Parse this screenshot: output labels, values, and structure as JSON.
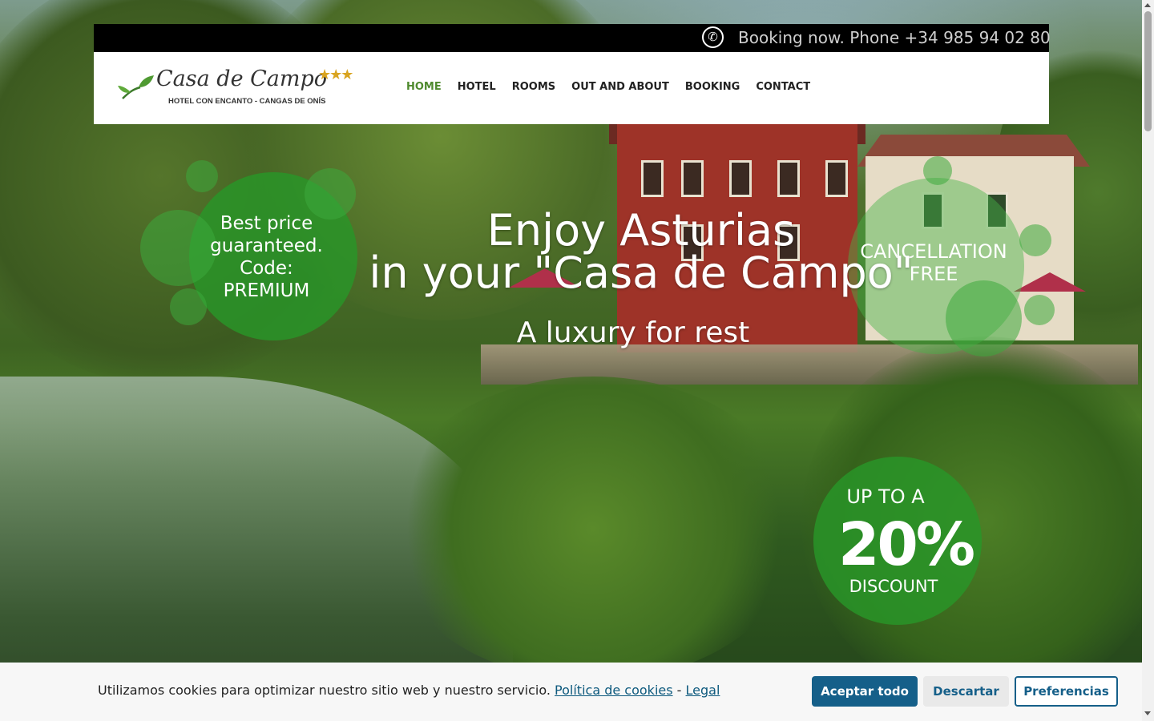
{
  "header": {
    "phone_text": "Booking now. Phone +34 985 94 02 80",
    "phone_icon": "phone-icon"
  },
  "logo": {
    "name": "Casa de Campo",
    "stars": "★★★",
    "subtitle": "HOTEL CON ENCANTO - CANGAS DE ONÍS"
  },
  "nav": {
    "items": [
      {
        "label": "HOME",
        "active": true
      },
      {
        "label": "HOTEL"
      },
      {
        "label": "ROOMS"
      },
      {
        "label": "OUT AND ABOUT"
      },
      {
        "label": "BOOKING"
      },
      {
        "label": "CONTACT"
      }
    ],
    "active_color": "#4f8a2e"
  },
  "hero": {
    "line1": "Enjoy Asturias",
    "line2": "in your \"Casa de Campo\"",
    "subtitle": "A luxury for rest"
  },
  "badges": {
    "price": {
      "l1": "Best price",
      "l2": "guaranteed.",
      "l3": "Code:",
      "l4": "PREMIUM"
    },
    "cancellation": {
      "l1": "CANCELLATION",
      "l2": "FREE"
    },
    "discount": {
      "l1": "UP TO A",
      "l2": "20%",
      "l3": "DISCOUNT"
    }
  },
  "cookie": {
    "message": "Utilizamos cookies para optimizar nuestro sitio web y nuestro servicio.",
    "policy_link": "Política de cookies",
    "separator": "-",
    "legal_link": "Legal",
    "accept": "Aceptar todo",
    "reject": "Descartar",
    "preferences": "Preferencias",
    "button_color": "#155f89"
  }
}
